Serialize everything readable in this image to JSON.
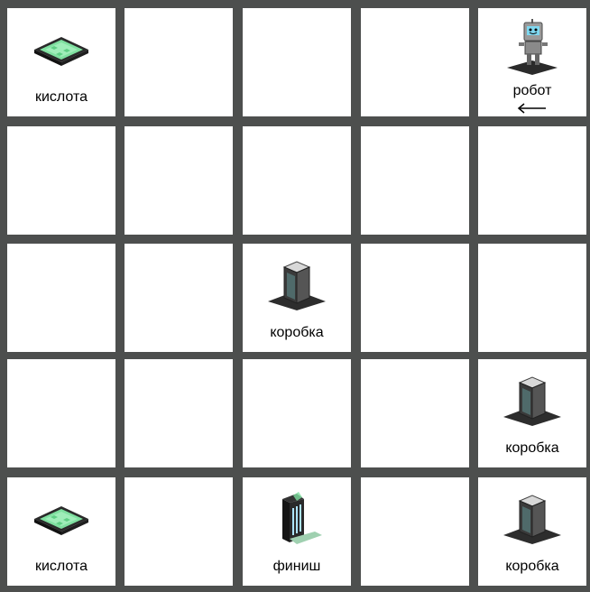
{
  "grid": {
    "rows": 5,
    "cols": 5,
    "background_color": "#4d4f4e",
    "cell_color": "#ffffff"
  },
  "items": [
    {
      "row": 0,
      "col": 0,
      "type": "acid",
      "icon": "acid-pad-icon",
      "label": "кислота"
    },
    {
      "row": 0,
      "col": 4,
      "type": "robot",
      "icon": "robot-icon",
      "label": "робот",
      "direction": "left",
      "direction_icon": "arrow-left-icon"
    },
    {
      "row": 2,
      "col": 2,
      "type": "box",
      "icon": "box-icon",
      "label": "коробка"
    },
    {
      "row": 3,
      "col": 4,
      "type": "box",
      "icon": "box-icon",
      "label": "коробка"
    },
    {
      "row": 4,
      "col": 0,
      "type": "acid",
      "icon": "acid-pad-icon",
      "label": "кислота"
    },
    {
      "row": 4,
      "col": 2,
      "type": "finish",
      "icon": "finish-icon",
      "label": "финиш"
    },
    {
      "row": 4,
      "col": 4,
      "type": "box",
      "icon": "box-icon",
      "label": "коробка"
    }
  ]
}
